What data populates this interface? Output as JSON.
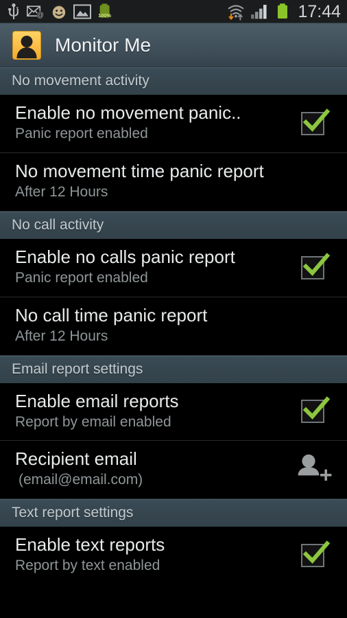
{
  "statusbar": {
    "icons": [
      {
        "name": "usb-icon"
      },
      {
        "name": "email-icon"
      },
      {
        "name": "smiley-icon"
      },
      {
        "name": "image-icon"
      },
      {
        "name": "battery-charge-icon",
        "label": "100%"
      }
    ],
    "right_icons": [
      {
        "name": "wifi-transfer-icon"
      },
      {
        "name": "cellular-signal-icon"
      },
      {
        "name": "battery-icon"
      }
    ],
    "clock": "17:44",
    "battery_label": "100%",
    "colors": {
      "background": "#1b1c1e",
      "text": "#cfd2d4",
      "battery_green": "#8bc42a",
      "accent_orange": "#e8860f"
    }
  },
  "titlebar": {
    "title": "Monitor Me",
    "app_icon": "person-avatar-icon",
    "colors": {
      "gradient_top": "#4c5d68",
      "gradient_bottom": "#35424c",
      "icon_orange": "#fcc04a",
      "title_text": "#f1f3f4"
    }
  },
  "colors": {
    "section_header_bg": "#36454e",
    "section_header_text": "#c3cbcf",
    "row_title": "#e8eaeb",
    "row_subtitle": "#8f9698",
    "check_green": "#8cc63f",
    "divider": "#2b2b2b",
    "page_bg": "#000000"
  },
  "sections": [
    {
      "header": "No movement activity",
      "rows": [
        {
          "title": "Enable no movement panic..",
          "subtitle": "Panic report enabled",
          "widget": "checkbox",
          "checked": true
        },
        {
          "title": "No movement time panic report",
          "subtitle": "After 12 Hours",
          "widget": "none",
          "checked": false
        }
      ]
    },
    {
      "header": "No call activity",
      "rows": [
        {
          "title": "Enable no calls panic report",
          "subtitle": "Panic report enabled",
          "widget": "checkbox",
          "checked": true
        },
        {
          "title": "No call time panic report",
          "subtitle": "After 12 Hours",
          "widget": "none",
          "checked": false
        }
      ]
    },
    {
      "header": "Email report settings",
      "rows": [
        {
          "title": "Enable email reports",
          "subtitle": "Report by email enabled",
          "widget": "checkbox",
          "checked": true
        },
        {
          "title": "Recipient email",
          "subtitle": "(email@email.com)",
          "widget": "add-person",
          "checked": false
        }
      ]
    },
    {
      "header": "Text report settings",
      "rows": [
        {
          "title": "Enable text reports",
          "subtitle": "Report by text enabled",
          "widget": "checkbox",
          "checked": true
        }
      ]
    }
  ]
}
